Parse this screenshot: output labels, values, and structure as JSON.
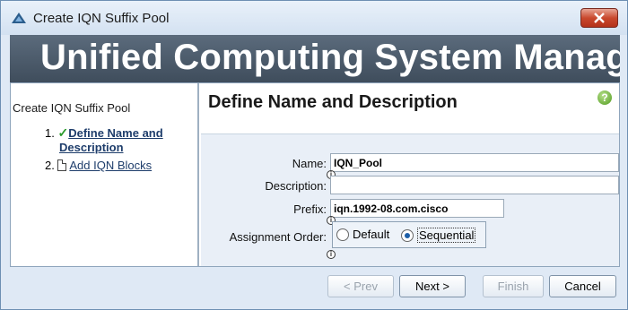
{
  "window": {
    "title": "Create IQN Suffix Pool",
    "close_icon": "close-icon"
  },
  "banner": {
    "text": "Unified Computing System Manager"
  },
  "sidebar": {
    "title": "Create IQN Suffix Pool",
    "steps": [
      {
        "number": "1.",
        "label_line1": "Define Name and",
        "label_line2": "Description",
        "status": "completed-check"
      },
      {
        "number": "2.",
        "label": "Add IQN Blocks",
        "status": "pending-doc"
      }
    ]
  },
  "main": {
    "page_title": "Define Name and Description",
    "help_icon": "?"
  },
  "form": {
    "name_label": "Name:",
    "name_value": "IQN_Pool",
    "description_label": "Description:",
    "description_value": "",
    "prefix_label": "Prefix:",
    "prefix_value": "iqn.1992-08.com.cisco",
    "assignment_label": "Assignment Order:",
    "assignment_options": [
      "Default",
      "Sequential"
    ],
    "assignment_selected": "Sequential",
    "info_marker": "i"
  },
  "footer": {
    "prev_label": "< Prev",
    "next_label": "Next >",
    "finish_label": "Finish",
    "cancel_label": "Cancel"
  },
  "colors": {
    "banner_bg": "#4a5a6b",
    "link": "#1e3d6b",
    "check": "#2a9a2a",
    "close_btn": "#c9492e"
  }
}
